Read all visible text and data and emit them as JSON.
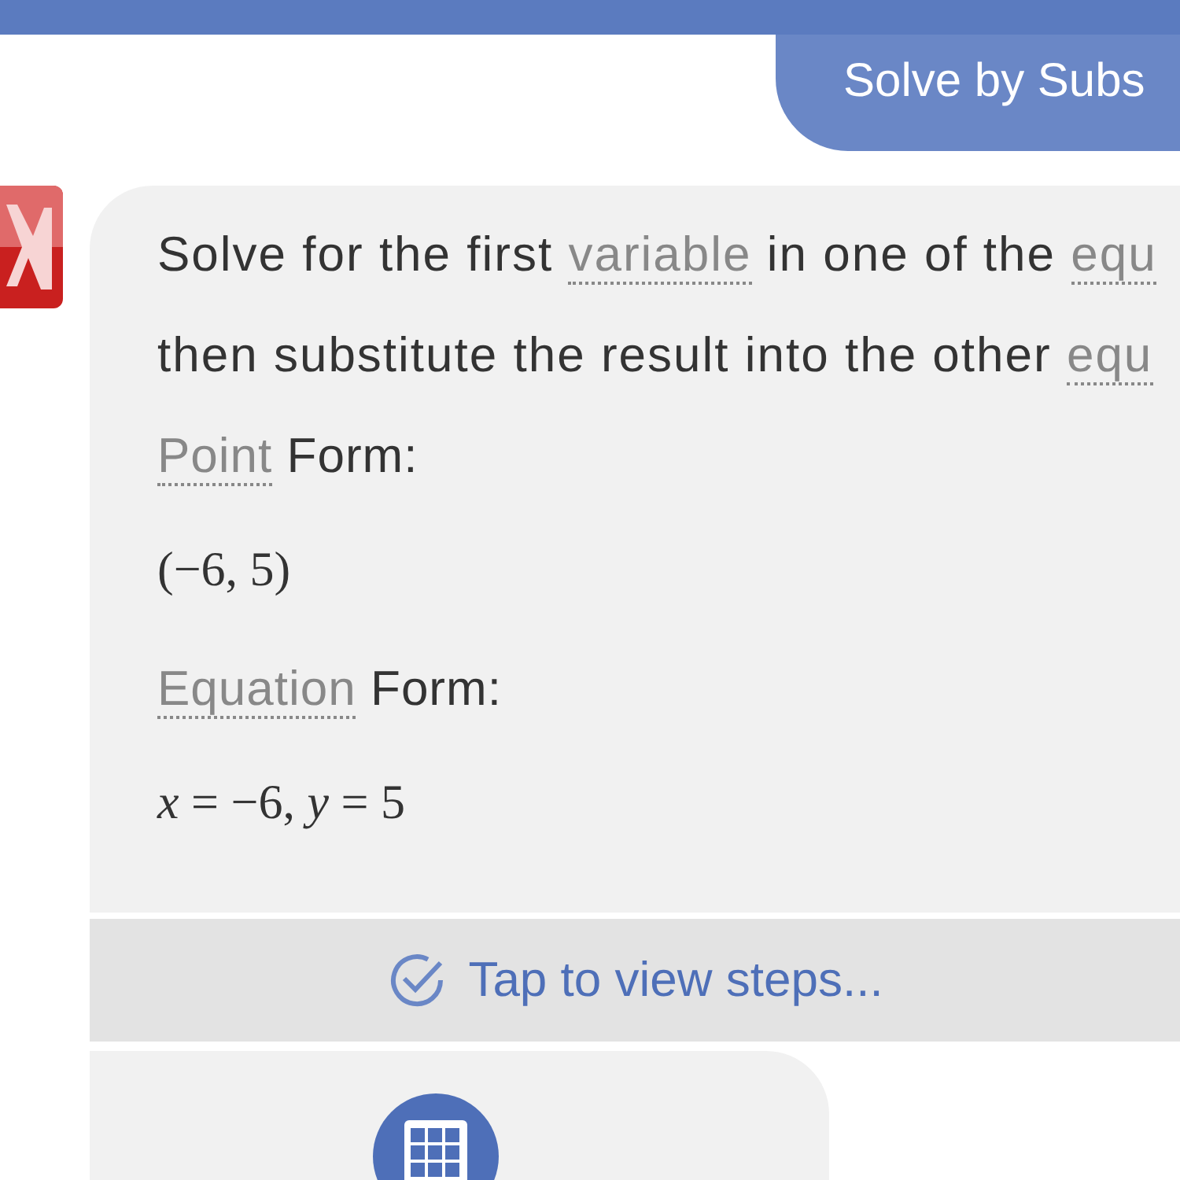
{
  "method_button": "Solve by Subs",
  "lines": [
    [
      {
        "text": "Solve for the first ",
        "term": false
      },
      {
        "text": "variable",
        "term": true
      },
      {
        "text": " in one of the ",
        "term": false
      },
      {
        "text": "equ",
        "term": true
      }
    ],
    [
      {
        "text": "then substitute the result into the other ",
        "term": false
      },
      {
        "text": "equ",
        "term": true
      }
    ]
  ],
  "forms": [
    {
      "term": "Point",
      "label": " Form:",
      "math": "(−6, 5)"
    },
    {
      "term": "Equation",
      "label": " Form:",
      "math": "*x* = −6, *y* = 5"
    }
  ],
  "steps_link": "Tap to view steps..."
}
